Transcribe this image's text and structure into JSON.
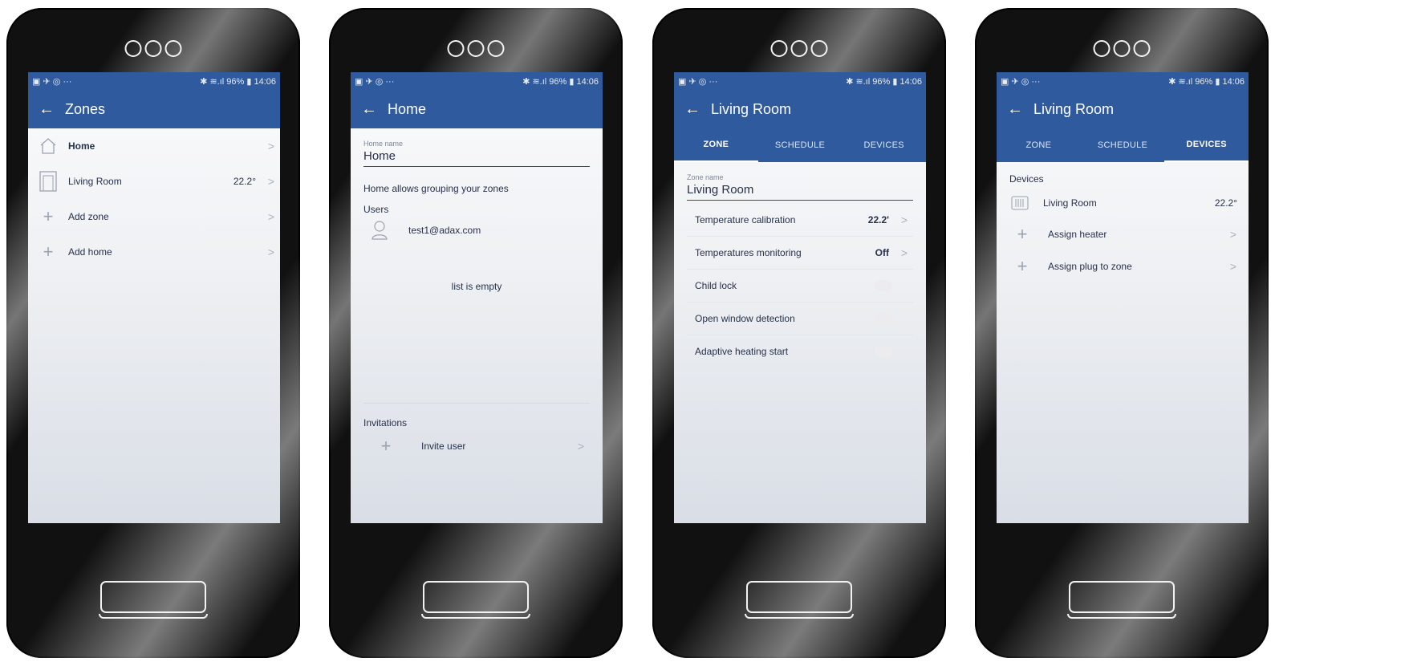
{
  "status": {
    "left_icons": "▣ ✈ ◎ ···",
    "right": "✱ ≋.ıl 96% ▮ 14:06"
  },
  "screens": {
    "zones": {
      "title": "Zones",
      "items": [
        {
          "label": "Home",
          "value": "",
          "icon": "house-icon"
        },
        {
          "label": "Living Room",
          "value": "22.2°",
          "icon": "room-icon"
        },
        {
          "label": "Add zone",
          "value": "",
          "icon": "plus-icon"
        },
        {
          "label": "Add home",
          "value": "",
          "icon": "plus-icon"
        }
      ]
    },
    "home": {
      "title": "Home",
      "field_label": "Home name",
      "field_value": "Home",
      "description": "Home allows grouping your zones",
      "users_label": "Users",
      "user_email": "test1@adax.com",
      "empty_text": "list is empty",
      "invitations_label": "Invitations",
      "invite_label": "Invite user"
    },
    "living_zone": {
      "title": "Living Room",
      "tabs": [
        "ZONE",
        "SCHEDULE",
        "DEVICES"
      ],
      "field_label": "Zone name",
      "field_value": "Living Room",
      "settings": [
        {
          "label": "Temperature calibration",
          "value": "22.2'",
          "type": "value"
        },
        {
          "label": "Temperatures monitoring",
          "value": "Off",
          "type": "value"
        },
        {
          "label": "Child lock",
          "value": "",
          "type": "toggle"
        },
        {
          "label": "Open window detection",
          "value": "",
          "type": "toggle"
        },
        {
          "label": "Adaptive heating start",
          "value": "",
          "type": "toggle"
        }
      ]
    },
    "living_devices": {
      "title": "Living Room",
      "tabs": [
        "ZONE",
        "SCHEDULE",
        "DEVICES"
      ],
      "devices_label": "Devices",
      "devices": [
        {
          "label": "Living Room",
          "value": "22.2°",
          "icon": "heater-icon"
        },
        {
          "label": "Assign heater",
          "value": "",
          "icon": "plus-icon"
        },
        {
          "label": "Assign plug to zone",
          "value": "",
          "icon": "plus-icon"
        }
      ]
    }
  },
  "icons": {
    "back": "←",
    "chevron": ">",
    "plus": "+"
  },
  "colors": {
    "appbar": "#2f5a9d",
    "text": "#26324a"
  }
}
